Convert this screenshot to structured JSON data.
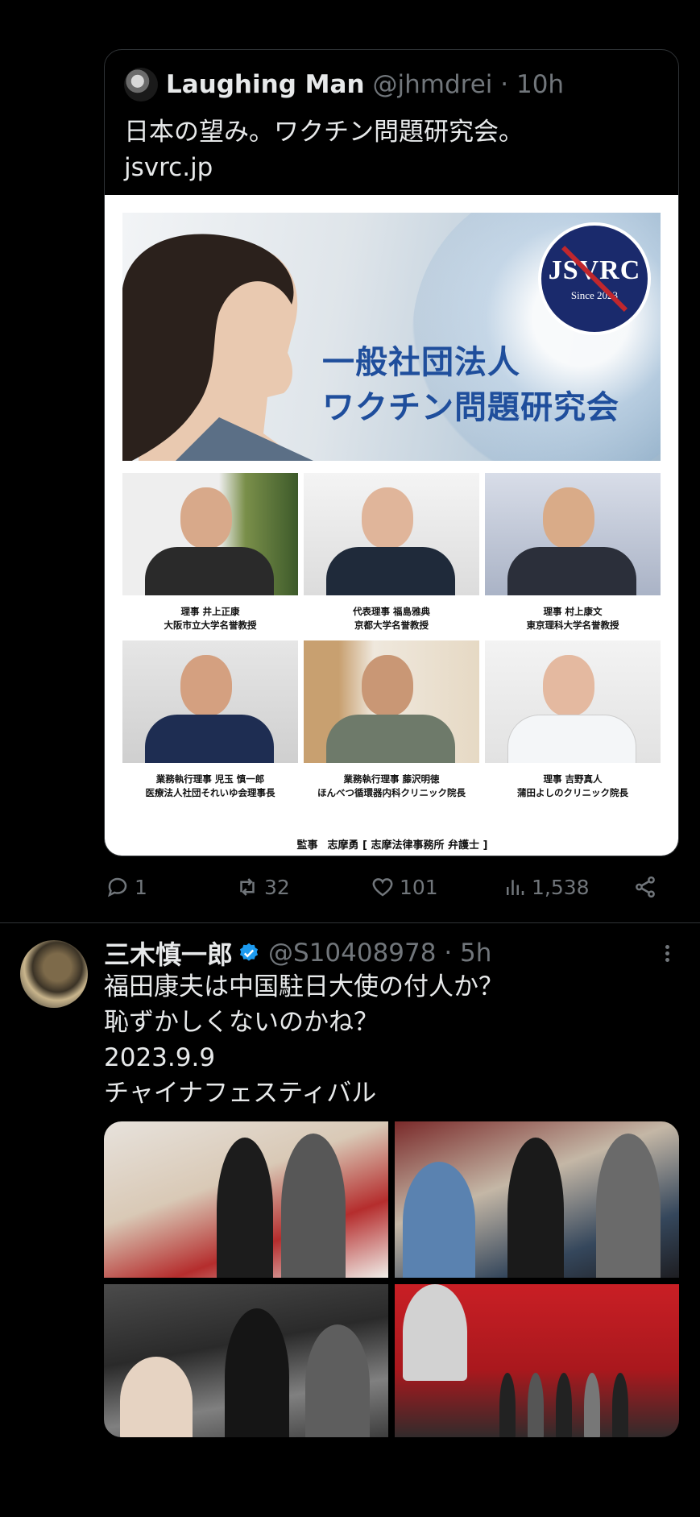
{
  "quoted_tweet": {
    "author_name": "Laughing Man",
    "author_handle": "@jhmdrei · 10h",
    "text": "日本の望み。ワクチン問題研究会。",
    "link": "jsvrc.jp",
    "image": {
      "logo_text": "JSVRC",
      "logo_since": "Since 2023",
      "title_line1": "一般社団法人",
      "title_line2": "ワクチン問題研究会",
      "people": [
        {
          "role": "理事 井上正康",
          "affiliation": "大阪市立大学名誉教授"
        },
        {
          "role": "代表理事 福島雅典",
          "affiliation": "京都大学名誉教授"
        },
        {
          "role": "理事 村上康文",
          "affiliation": "東京理科大学名誉教授"
        },
        {
          "role": "業務執行理事 児玉 慎一郎",
          "affiliation": "医療法人社団それいゆ会理事長"
        },
        {
          "role": "業務執行理事 藤沢明徳",
          "affiliation": "ほんべつ循環器内科クリニック院長"
        },
        {
          "role": "理事 吉野真人",
          "affiliation": "蒲田よしのクリニック院長"
        }
      ],
      "supervisor_label": "監事",
      "supervisor_name": "志摩勇 [ 志摩法律事務所 弁護士 ]"
    }
  },
  "actions": {
    "replies": "1",
    "reposts": "32",
    "likes": "101",
    "views": "1,538"
  },
  "tweet": {
    "author_name": "三木慎一郎",
    "author_handle": "@S10408978 · 5h",
    "lines": [
      "福田康夫は中国駐日大使の付人か？",
      "恥ずかしくないのかね？",
      "2023.9.9",
      "チャイナフェスティバル"
    ]
  },
  "colors": {
    "background": "#000000",
    "text": "#e7e9ea",
    "muted": "#71767b",
    "border": "#2f3336",
    "verified": "#1d9bf0"
  }
}
